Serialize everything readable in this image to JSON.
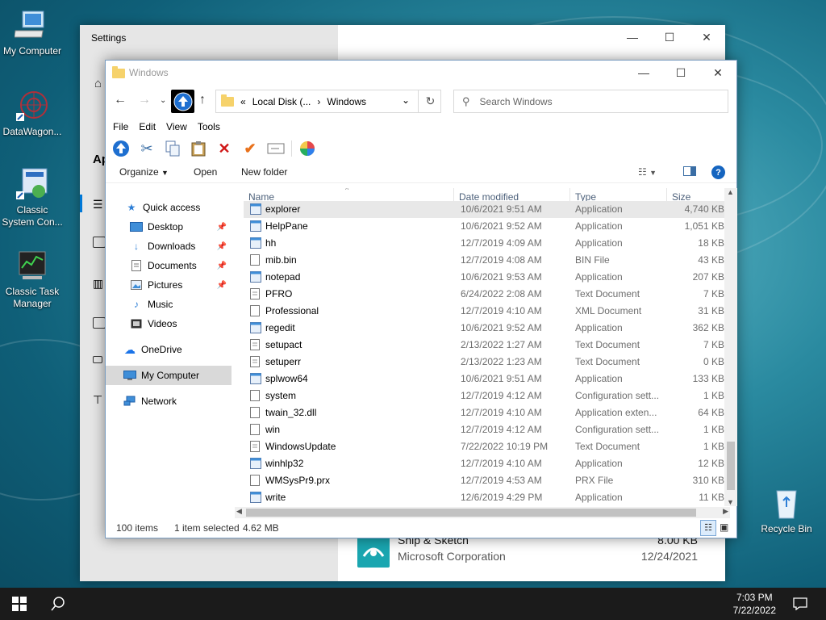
{
  "desktop": {
    "icons": [
      {
        "label": "My Computer"
      },
      {
        "label": "DataWagon..."
      },
      {
        "label": "Classic System Con..."
      },
      {
        "label": "Classic Task Manager"
      },
      {
        "label": "Recycle Bin"
      }
    ]
  },
  "settings": {
    "title": "Settings",
    "truncated_header": "Ap",
    "snip": {
      "name": "Snip & Sketch",
      "publisher": "Microsoft Corporation",
      "size": "8.00 KB",
      "date": "12/24/2021"
    }
  },
  "explorer": {
    "title": "Windows",
    "address": {
      "prefix": "«",
      "parent": "Local Disk (...",
      "sep": "›",
      "current": "Windows"
    },
    "search_placeholder": "Search Windows",
    "menu": [
      "File",
      "Edit",
      "View",
      "Tools"
    ],
    "commands": {
      "organize": "Organize",
      "open": "Open",
      "new_folder": "New folder"
    },
    "nav": {
      "quick_access": "Quick access",
      "items": [
        {
          "label": "Desktop",
          "icon": "desktop-icon"
        },
        {
          "label": "Downloads",
          "icon": "downloads-icon"
        },
        {
          "label": "Documents",
          "icon": "documents-icon"
        },
        {
          "label": "Pictures",
          "icon": "pictures-icon"
        },
        {
          "label": "Music",
          "icon": "music-icon"
        },
        {
          "label": "Videos",
          "icon": "videos-icon"
        }
      ],
      "onedrive": "OneDrive",
      "my_computer": "My Computer",
      "network": "Network"
    },
    "columns": {
      "name": "Name",
      "date": "Date modified",
      "type": "Type",
      "size": "Size"
    },
    "files": [
      {
        "name": "explorer",
        "date": "10/6/2021 9:51 AM",
        "type": "Application",
        "size": "4,740 KB"
      },
      {
        "name": "HelpPane",
        "date": "10/6/2021 9:52 AM",
        "type": "Application",
        "size": "1,051 KB"
      },
      {
        "name": "hh",
        "date": "12/7/2019 4:09 AM",
        "type": "Application",
        "size": "18 KB"
      },
      {
        "name": "mib.bin",
        "date": "12/7/2019 4:08 AM",
        "type": "BIN File",
        "size": "43 KB"
      },
      {
        "name": "notepad",
        "date": "10/6/2021 9:53 AM",
        "type": "Application",
        "size": "207 KB"
      },
      {
        "name": "PFRO",
        "date": "6/24/2022 2:08 AM",
        "type": "Text Document",
        "size": "7 KB"
      },
      {
        "name": "Professional",
        "date": "12/7/2019 4:10 AM",
        "type": "XML Document",
        "size": "31 KB"
      },
      {
        "name": "regedit",
        "date": "10/6/2021 9:52 AM",
        "type": "Application",
        "size": "362 KB"
      },
      {
        "name": "setupact",
        "date": "2/13/2022 1:27 AM",
        "type": "Text Document",
        "size": "7 KB"
      },
      {
        "name": "setuperr",
        "date": "2/13/2022 1:23 AM",
        "type": "Text Document",
        "size": "0 KB"
      },
      {
        "name": "splwow64",
        "date": "10/6/2021 9:51 AM",
        "type": "Application",
        "size": "133 KB"
      },
      {
        "name": "system",
        "date": "12/7/2019 4:12 AM",
        "type": "Configuration sett...",
        "size": "1 KB"
      },
      {
        "name": "twain_32.dll",
        "date": "12/7/2019 4:10 AM",
        "type": "Application exten...",
        "size": "64 KB"
      },
      {
        "name": "win",
        "date": "12/7/2019 4:12 AM",
        "type": "Configuration sett...",
        "size": "1 KB"
      },
      {
        "name": "WindowsUpdate",
        "date": "7/22/2022 10:19 PM",
        "type": "Text Document",
        "size": "1 KB"
      },
      {
        "name": "winhlp32",
        "date": "12/7/2019 4:10 AM",
        "type": "Application",
        "size": "12 KB"
      },
      {
        "name": "WMSysPr9.prx",
        "date": "12/7/2019 4:53 AM",
        "type": "PRX File",
        "size": "310 KB"
      },
      {
        "name": "write",
        "date": "12/6/2019 4:29 PM",
        "type": "Application",
        "size": "11 KB"
      }
    ],
    "status": {
      "count": "100 items",
      "selected": "1 item selected",
      "size": "4.62 MB"
    }
  },
  "taskbar": {
    "time": "7:03 PM",
    "date": "7/22/2022"
  }
}
